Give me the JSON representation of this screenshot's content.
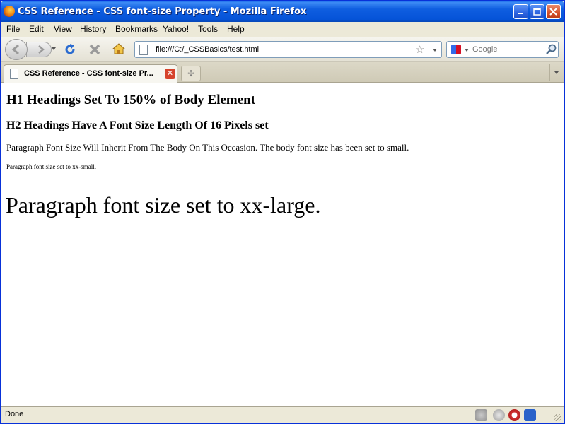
{
  "window": {
    "title": "CSS Reference - CSS font-size Property - Mozilla Firefox"
  },
  "menu": {
    "items": [
      "File",
      "Edit",
      "View",
      "History",
      "Bookmarks",
      "Yahoo!",
      "Tools",
      "Help"
    ]
  },
  "navbar": {
    "url": "file:///C:/_CSSBasics/test.html",
    "search_placeholder": "Google"
  },
  "tabs": [
    {
      "label": "CSS Reference - CSS font-size Pr...",
      "active": true
    }
  ],
  "content": {
    "h1": "H1 Headings Set To 150% of Body Element",
    "h2": "H2 Headings Have A Font Size Length Of 16 Pixels set",
    "p1": "Paragraph Font Size Will Inherit From The Body On This Occasion. The body font size has been set to small.",
    "p2": "Paragraph font size set to xx-small.",
    "p3": "Paragraph font size set to xx-large."
  },
  "status": {
    "text": "Done"
  },
  "colors": {
    "titlebar": "#0553d8",
    "close_button": "#d6432c",
    "chrome": "#ece9d8"
  }
}
